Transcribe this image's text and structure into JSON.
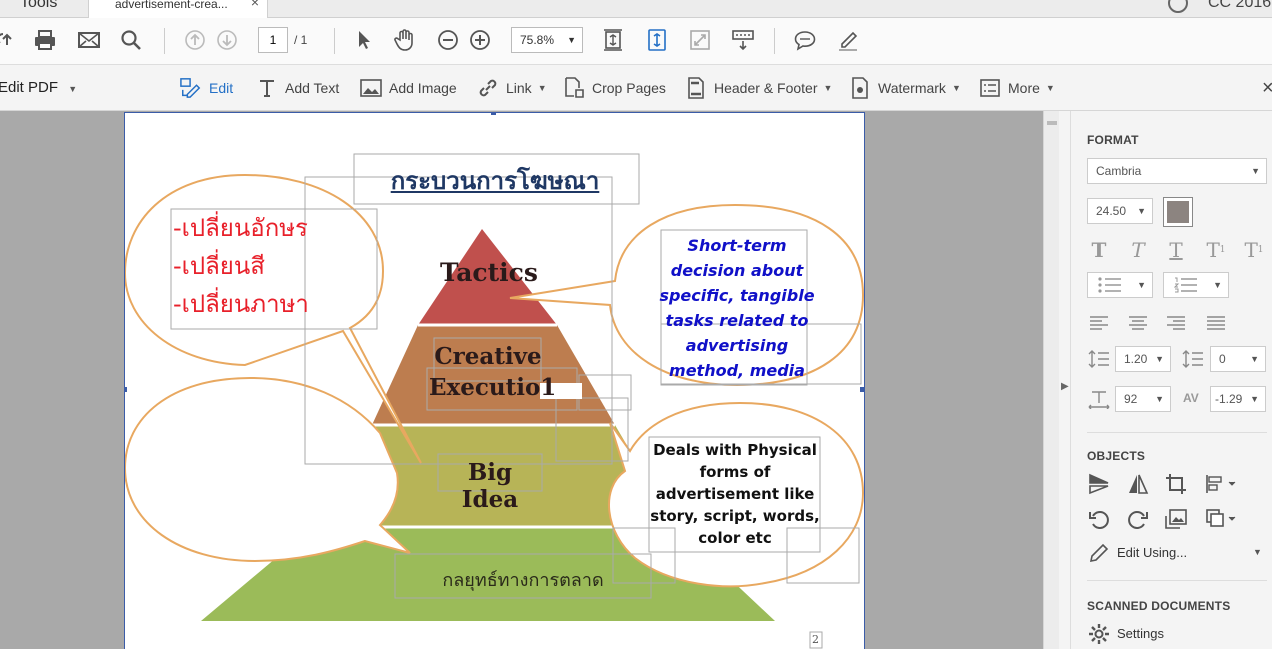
{
  "tabs": {
    "tools": "Tools",
    "document": "advertisement-crea...",
    "close": "×",
    "right_label": "CC 2016"
  },
  "toolbar": {
    "page_current": "1",
    "page_total": "/ 1",
    "zoom": "75.8%"
  },
  "edit_toolbar": {
    "title": "Edit PDF",
    "items": {
      "edit": "Edit",
      "add_text": "Add Text",
      "add_image": "Add Image",
      "link": "Link",
      "crop_pages": "Crop Pages",
      "header_footer": "Header & Footer",
      "watermark": "Watermark",
      "more": "More"
    },
    "close": "×"
  },
  "page": {
    "title": "กระบวนการโฆษณา",
    "left_bubble_lines": [
      "-เปลี่ยนอักษร",
      "-เปลี่ยนสี",
      "-เปลี่ยนภาษา"
    ],
    "pyramid": {
      "tier1": "Tactics",
      "tier2_line1": "Creative",
      "tier2_line2": "Executio1",
      "tier3": "Big Idea",
      "tier4": "กลยุทธ์ทางการตลาด"
    },
    "right_top_bubble": [
      "Short-term",
      "decision about",
      "specific,  tangible",
      "tasks related to",
      "advertising",
      "method,  media"
    ],
    "right_bottom_bubble": [
      "Deals with Physical",
      "forms of",
      "advertisement like",
      "story, script, words,",
      "color etc"
    ],
    "page_number": "2"
  },
  "format_panel": {
    "heading": "FORMAT",
    "font": "Cambria",
    "font_size": "24.50",
    "text_color": "#8c8480",
    "line_spacing": "1.20",
    "paragraph_spacing": "0",
    "horizontal_scaling": "92",
    "char_spacing": "-1.29"
  },
  "objects_panel": {
    "heading": "OBJECTS",
    "edit_using": "Edit Using..."
  },
  "scanned_panel": {
    "heading": "SCANNED DOCUMENTS",
    "settings": "Settings"
  },
  "colors": {
    "accent": "#2470c6",
    "pyramid_red": "#c0504d",
    "pyramid_brown": "#bd7d4f",
    "pyramid_olive": "#b7b457",
    "pyramid_green": "#9bbb59",
    "bubble_stroke": "#e8a860",
    "left_text": "#e8202a",
    "right_text": "#1010c8",
    "title_text": "#1f3864"
  }
}
